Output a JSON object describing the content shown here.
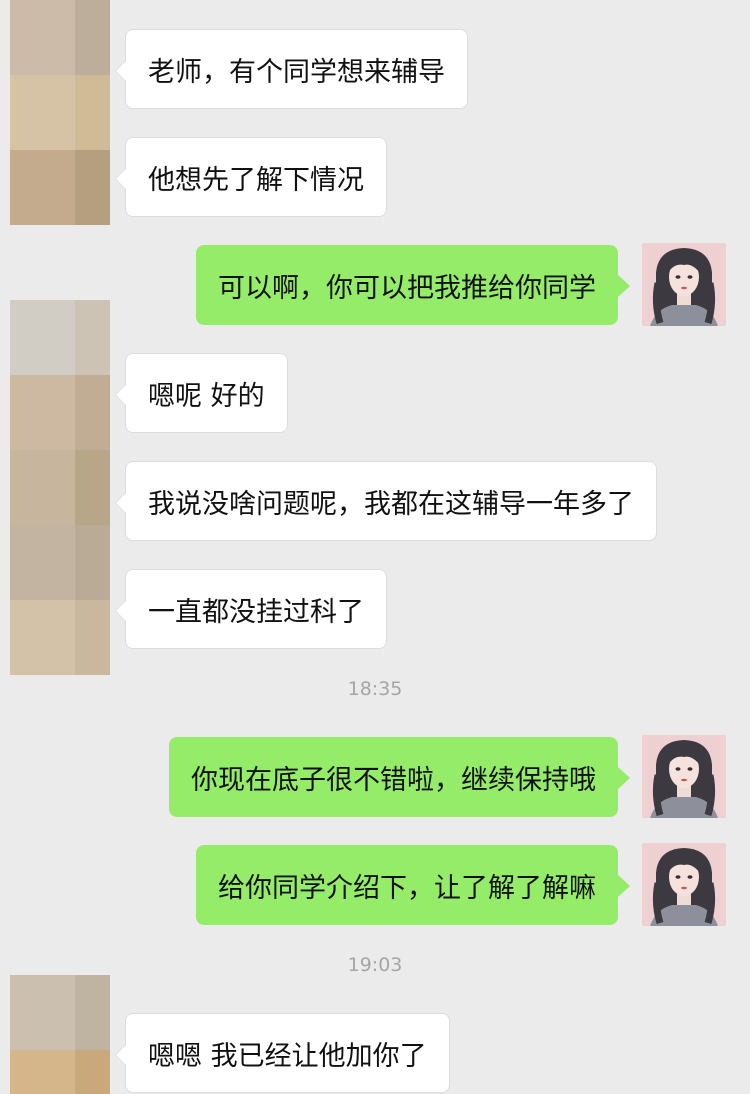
{
  "colors": {
    "background": "#ebebeb",
    "incoming_bubble": "#ffffff",
    "outgoing_bubble": "#95ec69",
    "timestamp_text": "#a5a5a5"
  },
  "messages": [
    {
      "sender": "other",
      "text": "老师，有个同学想来辅导"
    },
    {
      "sender": "other",
      "text": "他想先了解下情况"
    },
    {
      "sender": "me",
      "text": "可以啊，你可以把我推给你同学"
    },
    {
      "sender": "other",
      "text": "嗯呢 好的"
    },
    {
      "sender": "other",
      "text": "我说没啥问题呢，我都在这辅导一年多了"
    },
    {
      "sender": "other",
      "text": "一直都没挂过科了"
    },
    {
      "sender": "me",
      "text": "你现在底子很不错啦，继续保持哦"
    },
    {
      "sender": "me",
      "text": "给你同学介绍下，让了解了解嘛"
    },
    {
      "sender": "other",
      "text": "嗯嗯 我已经让他加你了"
    }
  ],
  "timestamps": [
    "18:35",
    "19:03"
  ],
  "icons": {
    "other_avatar": "pixelated-avatar-icon",
    "self_avatar": "girl-portrait-avatar-icon"
  }
}
